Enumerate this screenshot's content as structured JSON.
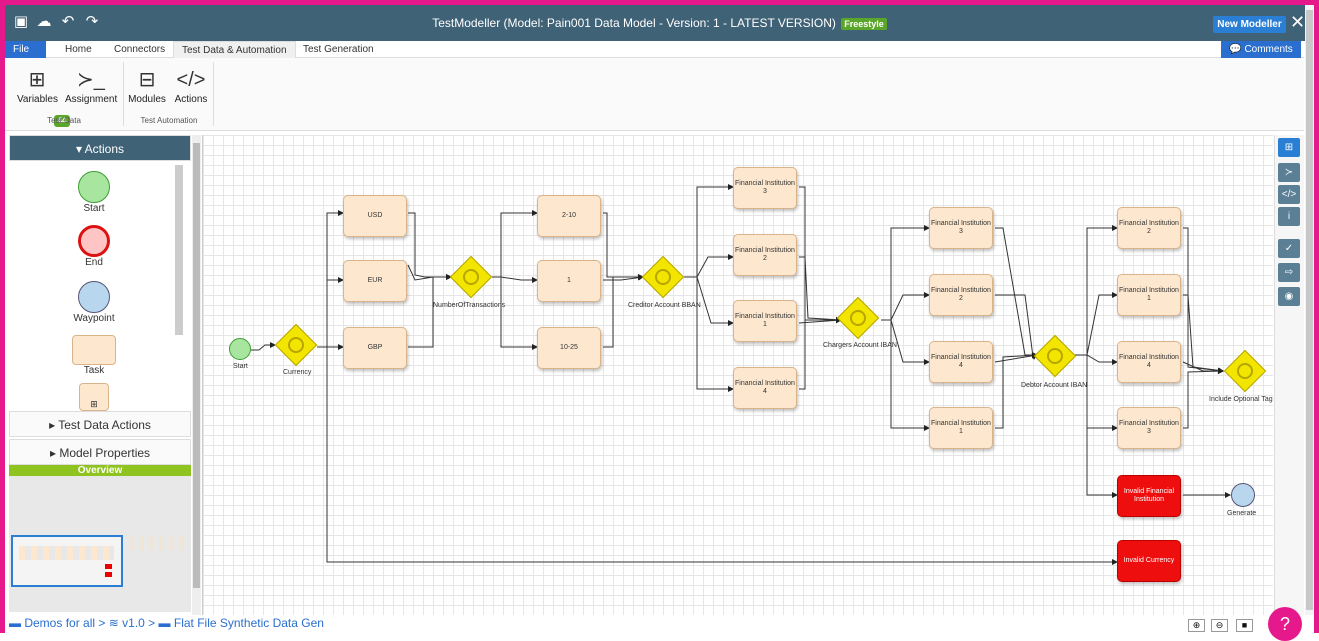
{
  "window": {
    "title": "TestModeller (Model: Pain001 Data Model - Version: 1 - LATEST VERSION)",
    "title_badge": "Freestyle",
    "new_modeller": "New Modeller",
    "close": "✕"
  },
  "menu": {
    "file": "File",
    "tabs": [
      "Home",
      "Connectors",
      "Test Data & Automation",
      "Test Generation"
    ],
    "comments": "Comments"
  },
  "ribbon": {
    "variables": "Variables",
    "variables_count": "44",
    "assignment": "Assignment",
    "modules": "Modules",
    "actions": "Actions",
    "group_test_data": "Test Data",
    "group_test_automation": "Test Automation"
  },
  "left_panel": {
    "actions_header": "Actions",
    "shapes": {
      "start": "Start",
      "end": "End",
      "waypoint": "Waypoint",
      "task": "Task"
    },
    "test_data_actions": "Test Data Actions",
    "model_properties": "Model Properties",
    "overview": "Overview"
  },
  "diagram": {
    "start": "Start",
    "currency": "Currency",
    "usd": "USD",
    "eur": "EUR",
    "gbp": "GBP",
    "number_of_transactions": "NumberOfTransactions",
    "range_2_10": "2-10",
    "one": "1",
    "range_10_25": "10-25",
    "creditor_bban": "Creditor Account BBAN",
    "fi3": "Financial Institution 3",
    "fi2": "Financial Institution 2",
    "fi1": "Financial Institution 1",
    "fi4": "Financial Institution 4",
    "chargers_iban": "Chargers Account IBAN",
    "debtor_iban": "Debtor Account IBAN",
    "include_optional": "Include Optional Tag",
    "invalid_fi": "Invalid Financial Institution",
    "invalid_currency": "Invalid Currency",
    "generate": "Generate"
  },
  "breadcrumb": {
    "root": "Demos for all",
    "version": "v1.0",
    "folder": "Flat File Synthetic Data Gen"
  },
  "colors": {
    "accent": "#e6198c",
    "header": "#3f6277",
    "brand_blue": "#2a6fd0",
    "node_fill": "#fde8cf",
    "gateway": "#f2e600",
    "error": "#ee0e0e"
  }
}
